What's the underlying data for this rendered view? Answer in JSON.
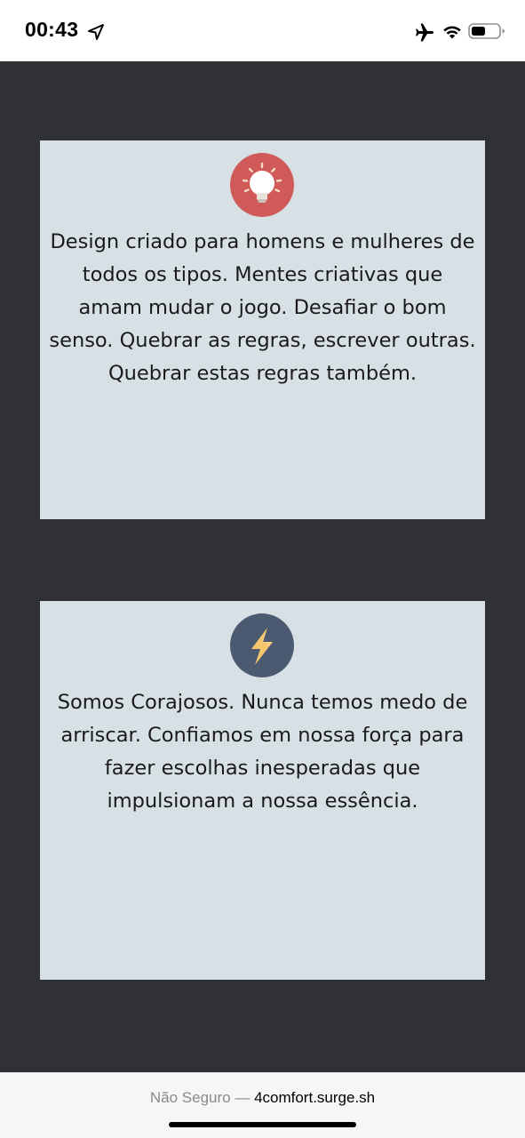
{
  "status_bar": {
    "time": "00:43",
    "icons": [
      "location-arrow-icon",
      "airplane-icon",
      "wifi-icon",
      "battery-icon"
    ]
  },
  "cards": [
    {
      "icon": "lightbulb-icon",
      "icon_color": "#d05a58",
      "text": "Design criado para homens e mulheres de todos os tipos. Mentes criativas que amam mudar o jogo. Desafiar o bom senso. Quebrar as regras, escrever outras. Quebrar estas regras também."
    },
    {
      "icon": "lightning-bolt-icon",
      "icon_color": "#4b5a70",
      "text": "Somos Corajosos. Nunca temos medo de arriscar. Confiamos em nossa força para fazer escolhas inesperadas que impulsionam a nossa essência."
    }
  ],
  "browser": {
    "security_label": "Não Seguro —",
    "domain": "4comfort.surge.sh"
  },
  "colors": {
    "page_background": "#2f3136",
    "card_background": "#d7e1e5"
  }
}
